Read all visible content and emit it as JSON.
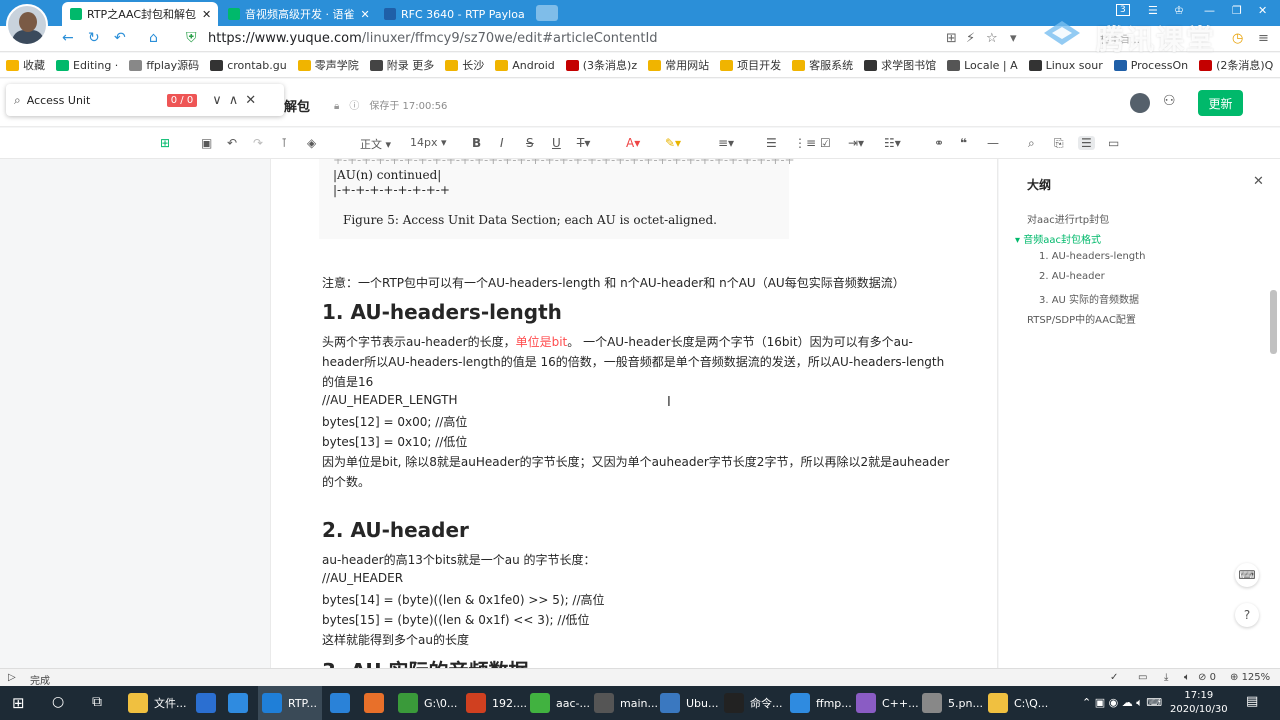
{
  "browser": {
    "tabs": [
      {
        "label": "RTP之AAC封包和解包",
        "favicon_color": "#00b96b"
      },
      {
        "label": "音视频高级开发 · 语雀",
        "favicon_color": "#00b96b"
      },
      {
        "label": "RFC 3640 - RTP Payloa",
        "favicon_color": "#1f5fa8"
      }
    ],
    "tab_close": "✕",
    "url_prefix": "https://",
    "url_domain": "www.yuque.com",
    "url_path": "/linuxer/ffmcy9/sz70we/edit#articleContentId",
    "badge": "3",
    "watermark": "腾讯课堂",
    "watermark_sub": "相手目…"
  },
  "bookmarks": [
    {
      "label": "收藏",
      "color": "#f5b400"
    },
    {
      "label": "Editing ·",
      "color": "#00b96b"
    },
    {
      "label": "ffplay源码",
      "color": "#888"
    },
    {
      "label": "crontab.gu",
      "color": "#333"
    },
    {
      "label": "零声学院",
      "color": "#f0b400"
    },
    {
      "label": "附录 更多",
      "color": "#444"
    },
    {
      "label": "长沙",
      "color": "#f0b400"
    },
    {
      "label": "Android",
      "color": "#f0b400"
    },
    {
      "label": "(3条消息)z",
      "color": "#c40000"
    },
    {
      "label": "常用网站",
      "color": "#f0b400"
    },
    {
      "label": "项目开发",
      "color": "#f0b400"
    },
    {
      "label": "客服系统",
      "color": "#f0b400"
    },
    {
      "label": "求学图书馆",
      "color": "#333"
    },
    {
      "label": "Locale | A",
      "color": "#555"
    },
    {
      "label": "Linux sour",
      "color": "#333"
    },
    {
      "label": "ProcessOn",
      "color": "#1f5fa8"
    },
    {
      "label": "(2条消息)Q",
      "color": "#c40000"
    }
  ],
  "find": {
    "query": "Access Unit",
    "count": "0 / 0"
  },
  "doc": {
    "title": "解包",
    "save_status": "保存于 17:00:56",
    "update_button": "更新"
  },
  "toolbar": {
    "paragraph": "正文",
    "font_size": "14px"
  },
  "content": {
    "code_lines": [
      "+-+-+-+-+-+-+-+-+-+-+-+-+-+-+-+-+-+-+-+-+-+-+-+-+-+-+-+-+-+-+-+-+",
      "|AU(n) continued|",
      "|-+-+-+-+-+-+-+-+",
      "Figure 5: Access Unit Data Section; each AU is octet-aligned."
    ],
    "note": "注意：一个RTP包中可以有一个AU-headers-length 和 n个AU-header和 n个AU（AU每包实际音频数据流）",
    "h1": "1. AU-headers-length",
    "p1_a": "头两个字节表示au-header的长度，",
    "p1_red": "单位是bit",
    "p1_b": "。 一个AU-header长度是两个字节（16bit）因为可以有多个au-",
    "p1_line2": "header所以AU-headers-length的值是 16的倍数，一般音频都是单个音频数据流的发送，所以AU-headers-length",
    "p1_line3": "的值是16",
    "p1_line4": "//AU_HEADER_LENGTH",
    "p1_line5": "bytes[12] = 0x00; //高位",
    "p1_line6": "bytes[13] = 0x10; //低位",
    "p1_line7": "因为单位是bit, 除以8就是auHeader的字节长度；又因为单个auheader字节长度2字节，所以再除以2就是auheader",
    "p1_line8": "的个数。",
    "h2": "2. AU-header",
    "p2_line1": "au-header的高13个bits就是一个au 的字节长度：",
    "p2_line2": "//AU_HEADER",
    "p2_line3": "bytes[14] = (byte)((len & 0x1fe0) >> 5); //高位",
    "p2_line4": "bytes[15] = (byte)((len & 0x1f) << 3); //低位",
    "p2_line5": "这样就能得到多个au的长度",
    "h3": "3. AU 实际的音频数据"
  },
  "outline": {
    "title": "大纲",
    "items": [
      {
        "label": "对aac进行rtp封包"
      },
      {
        "label": "音频aac封包格式"
      },
      {
        "label": "1. AU-headers-length"
      },
      {
        "label": "2. AU-header"
      },
      {
        "label": "3. AU 实际的音频数据"
      },
      {
        "label": "RTSP/SDP中的AAC配置"
      }
    ]
  },
  "statusbar": {
    "left": "完成",
    "zero": "0",
    "zoom": "125%"
  },
  "taskbar": {
    "items": [
      {
        "label": "文件...",
        "color": "#f0c040"
      },
      {
        "label": "",
        "color": "#2b6fd1"
      },
      {
        "label": "",
        "color": "#2f8be0"
      },
      {
        "label": "RTP...",
        "color": "#1f7fd8"
      },
      {
        "label": "",
        "color": "#2a82d8"
      },
      {
        "label": "",
        "color": "#e8702a"
      },
      {
        "label": "G:\\0...",
        "color": "#3a9a3a"
      },
      {
        "label": "192....",
        "color": "#d04020"
      },
      {
        "label": "aac-...",
        "color": "#41b240"
      },
      {
        "label": "main...",
        "color": "#555"
      },
      {
        "label": "Ubu...",
        "color": "#3a78c0"
      },
      {
        "label": "命令...",
        "color": "#222"
      },
      {
        "label": "ffmp...",
        "color": "#2f8be0"
      },
      {
        "label": "C++...",
        "color": "#8a5cc4"
      },
      {
        "label": "5.pn...",
        "color": "#888"
      },
      {
        "label": "C:\\Q...",
        "color": "#f0c040"
      }
    ],
    "time": "17:19",
    "date": "2020/10/30"
  }
}
